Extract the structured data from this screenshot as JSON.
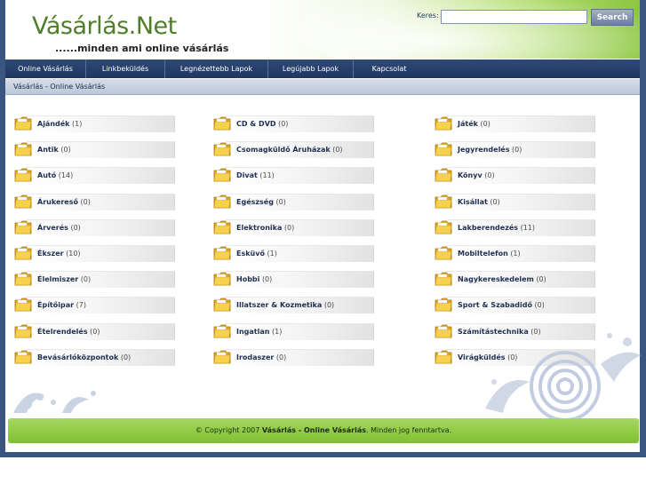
{
  "site": {
    "logo": "Vásárlás.Net",
    "tagline": "......minden ami online vásárlás"
  },
  "search": {
    "label": "Keres:",
    "value": "",
    "button_label": "Search"
  },
  "nav": {
    "items": [
      {
        "label": "Online Vásárlás"
      },
      {
        "label": "Linkbeküldés"
      },
      {
        "label": "Legnézettebb Lapok"
      },
      {
        "label": "Legújabb Lapok"
      },
      {
        "label": "Kapcsolat"
      }
    ]
  },
  "breadcrumb": "Vásárlás - Online Vásárlás",
  "categories": {
    "col1": [
      {
        "name": "Ajándék",
        "count": "(1)"
      },
      {
        "name": "Antik",
        "count": "(0)"
      },
      {
        "name": "Autó",
        "count": "(14)"
      },
      {
        "name": "Árukereső",
        "count": "(0)"
      },
      {
        "name": "Árverés",
        "count": "(0)"
      },
      {
        "name": "Ékszer",
        "count": "(10)"
      },
      {
        "name": "Élelmiszer",
        "count": "(0)"
      },
      {
        "name": "Építőipar",
        "count": "(7)"
      },
      {
        "name": "Ételrendelés",
        "count": "(0)"
      },
      {
        "name": "Bevásárlóközpontok",
        "count": "(0)"
      }
    ],
    "col2": [
      {
        "name": "CD & DVD",
        "count": "(0)"
      },
      {
        "name": "Csomagküldő Áruházak",
        "count": "(0)"
      },
      {
        "name": "Divat",
        "count": "(11)"
      },
      {
        "name": "Egészség",
        "count": "(0)"
      },
      {
        "name": "Elektronika",
        "count": "(0)"
      },
      {
        "name": "Esküvő",
        "count": "(1)"
      },
      {
        "name": "Hobbi",
        "count": "(0)"
      },
      {
        "name": "Illatszer & Kozmetika",
        "count": "(0)"
      },
      {
        "name": "Ingatlan",
        "count": "(1)"
      },
      {
        "name": "Irodaszer",
        "count": "(0)"
      }
    ],
    "col3": [
      {
        "name": "Játék",
        "count": "(0)"
      },
      {
        "name": "Jegyrendelés",
        "count": "(0)"
      },
      {
        "name": "Könyv",
        "count": "(0)"
      },
      {
        "name": "Kisállat",
        "count": "(0)"
      },
      {
        "name": "Lakberendezés",
        "count": "(11)"
      },
      {
        "name": "Mobiltelefon",
        "count": "(1)"
      },
      {
        "name": "Nagykereskedelem",
        "count": "(0)"
      },
      {
        "name": "Sport & Szabadidő",
        "count": "(0)"
      },
      {
        "name": "Számítástechnika",
        "count": "(0)"
      },
      {
        "name": "Virágküldés",
        "count": "(0)"
      }
    ]
  },
  "footer": {
    "prefix": "© Copyright 2007",
    "site_name": "Vásárlás - Online Vásárlás",
    "suffix": ". Minden jog fenntartva."
  },
  "icons": {
    "folder": "folder-icon",
    "decor": "floral-swirl-decoration"
  },
  "colors": {
    "nav_bg": "#1f3660",
    "footer_green": "#8cc63f",
    "logo_green": "#4f7d2a",
    "page_border": "#3a5680"
  }
}
